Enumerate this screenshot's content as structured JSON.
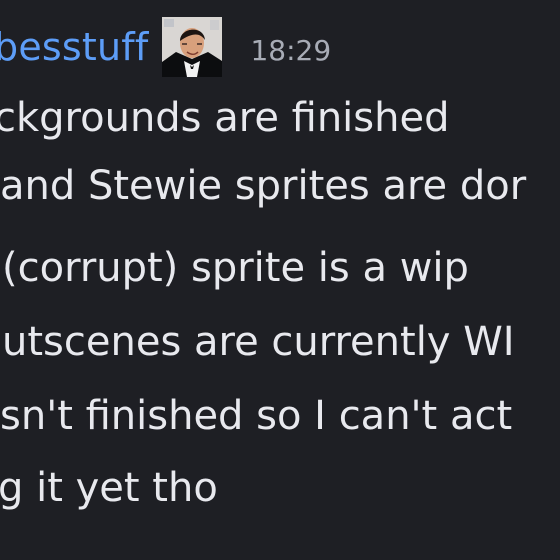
{
  "message": {
    "username": "besstuff",
    "timestamp": "18:29",
    "lines": [
      "ckgrounds are finished",
      "and Stewie sprites are dor",
      "(corrupt) sprite is a wip",
      "utscenes are currently WI",
      "sn't finished so I can't act",
      "g it yet tho"
    ]
  },
  "colors": {
    "background": "#1e1f24",
    "username": "#5d9df7",
    "text": "#e8e9ee",
    "timestamp": "#a8acb6"
  }
}
